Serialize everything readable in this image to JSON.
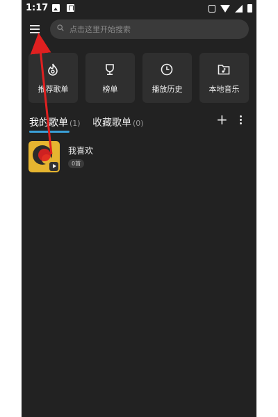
{
  "status_bar": {
    "time": "1:17"
  },
  "search": {
    "placeholder": "点击这里开始搜索"
  },
  "quick_actions": [
    {
      "label": "推荐歌单",
      "icon": "flame-icon"
    },
    {
      "label": "榜单",
      "icon": "trophy-icon"
    },
    {
      "label": "播放历史",
      "icon": "clock-icon"
    },
    {
      "label": "本地音乐",
      "icon": "music-folder-icon"
    }
  ],
  "tabs": [
    {
      "label": "我的歌单",
      "count": "(1)",
      "active": true
    },
    {
      "label": "收藏歌单",
      "count": "(0)",
      "active": false
    }
  ],
  "playlists": [
    {
      "name": "我喜欢",
      "count": "0首"
    }
  ],
  "colors": {
    "background": "#222222",
    "tab_accent": "#3aa0d8",
    "cover": "#e6b530",
    "annotation": "#e02020"
  }
}
